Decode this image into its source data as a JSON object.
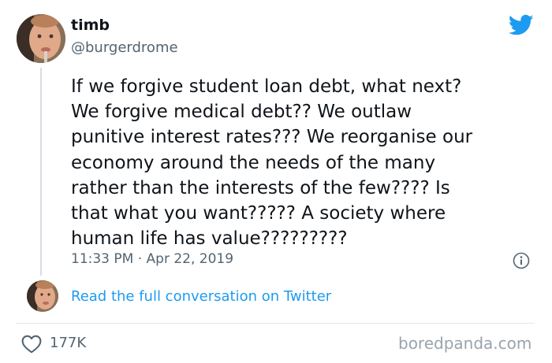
{
  "tweet": {
    "author": {
      "display_name": "timb",
      "handle": "@burgerdrome"
    },
    "text": "If we forgive student loan debt, what next?\nWe forgive medical debt?? We outlaw\npunitive interest rates??? We reorganise our\neconomy around the needs of the many\nrather than the interests of the few???? Is\nthat what you want????? A society where\nhuman life has value?????????",
    "timestamp": "11:33 PM · Apr 22, 2019",
    "likes": "177K"
  },
  "conversation_link": "Read the full conversation on Twitter",
  "watermark": "boredpanda.com",
  "icons": {
    "brand": "twitter-bird-icon",
    "info": "info-icon",
    "like": "heart-icon"
  },
  "colors": {
    "twitter_blue": "#1d9bf0",
    "secondary_text": "#536471",
    "primary_text": "#0f1419"
  }
}
